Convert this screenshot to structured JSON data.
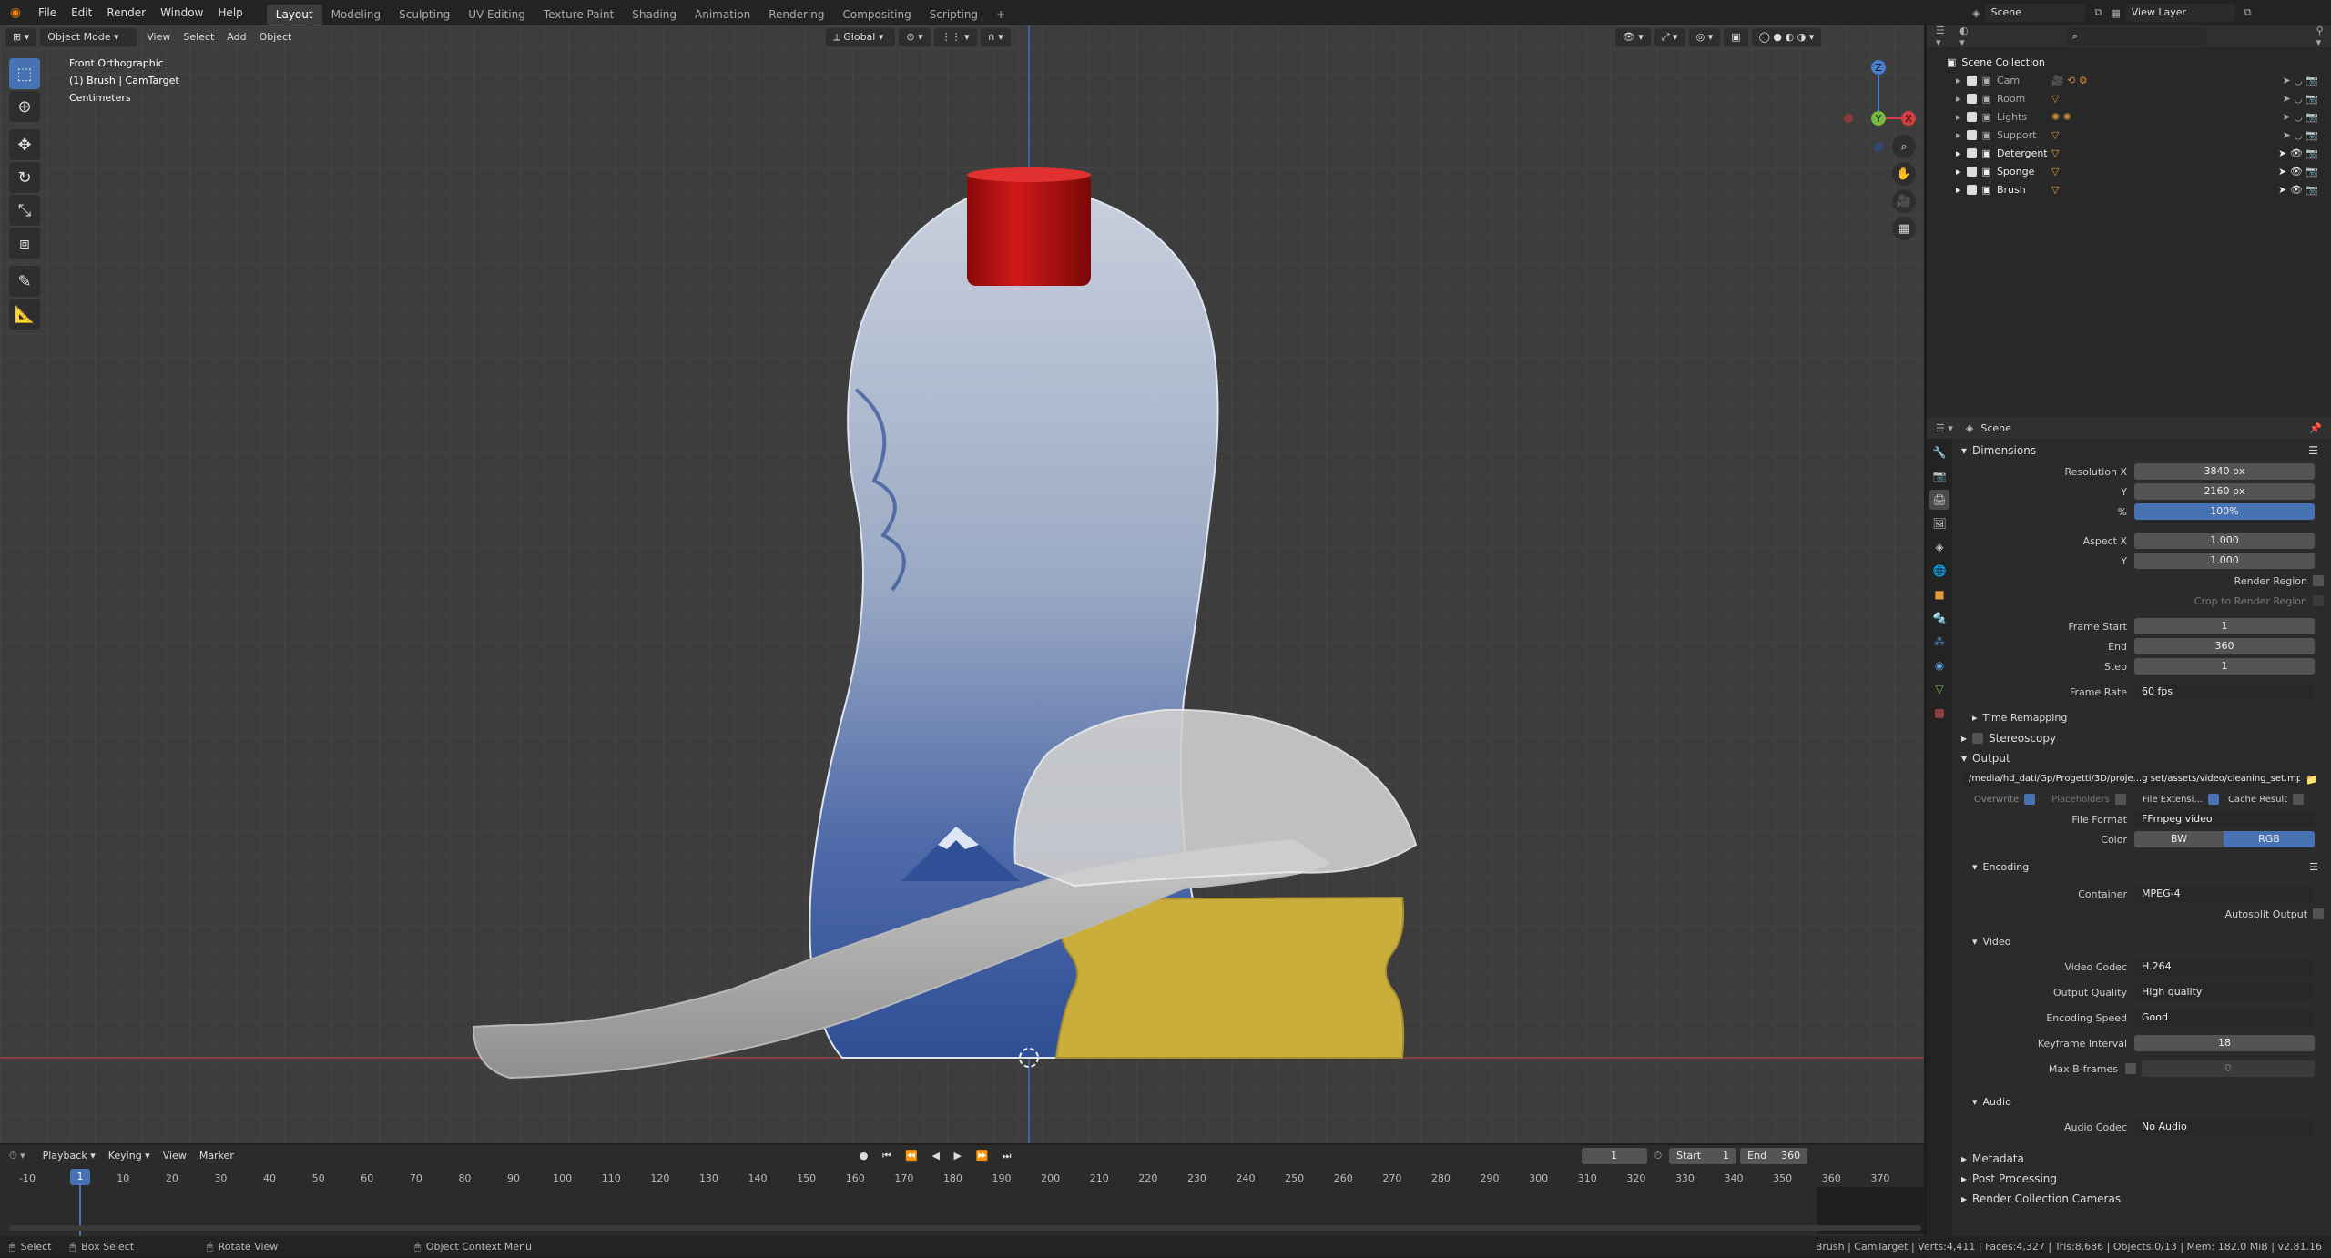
{
  "topbar": {
    "menus": [
      "File",
      "Edit",
      "Render",
      "Window",
      "Help"
    ],
    "workspaces": [
      "Layout",
      "Modeling",
      "Sculpting",
      "UV Editing",
      "Texture Paint",
      "Shading",
      "Animation",
      "Rendering",
      "Compositing",
      "Scripting"
    ],
    "active_workspace": "Layout",
    "add_tab": "+",
    "scene": "Scene",
    "view_layer": "View Layer"
  },
  "viewport": {
    "mode": "Object Mode",
    "menus": [
      "View",
      "Select",
      "Add",
      "Object"
    ],
    "orientation": "Global",
    "info_lines": [
      "Front Orthographic",
      "(1) Brush | CamTarget",
      "Centimeters"
    ],
    "gizmo": {
      "z": "Z",
      "y": "Y",
      "x": "X"
    }
  },
  "outliner": {
    "search_placeholder": "",
    "root": "Scene Collection",
    "items": [
      {
        "name": "Cam"
      },
      {
        "name": "Room"
      },
      {
        "name": "Lights"
      },
      {
        "name": "Support"
      },
      {
        "name": "Detergent"
      },
      {
        "name": "Sponge"
      },
      {
        "name": "Brush"
      }
    ]
  },
  "properties": {
    "context": "Scene",
    "dimensions": {
      "title": "Dimensions",
      "resolution_x_label": "Resolution X",
      "resolution_x": "3840 px",
      "y_label": "Y",
      "resolution_y": "2160 px",
      "pct_label": "%",
      "pct": "100%",
      "aspect_x_label": "Aspect X",
      "aspect_x": "1.000",
      "aspect_y_label": "Y",
      "aspect_y": "1.000",
      "render_region": "Render Region",
      "crop": "Crop to Render Region",
      "frame_start_label": "Frame Start",
      "frame_start": "1",
      "end_label": "End",
      "end": "360",
      "step_label": "Step",
      "step": "1",
      "frame_rate_label": "Frame Rate",
      "frame_rate": "60 fps"
    },
    "time_remapping": "Time Remapping",
    "stereoscopy": "Stereoscopy",
    "output": {
      "title": "Output",
      "path": "/media/hd_dati/Gp/Progetti/3D/proje...g set/assets/video/cleaning_set.mp4",
      "overwrite": "Overwrite",
      "placeholders": "Placeholders",
      "file_ext": "File Extensi...",
      "cache": "Cache Result",
      "file_format_label": "File Format",
      "file_format": "FFmpeg video",
      "color_label": "Color",
      "bw": "BW",
      "rgb": "RGB"
    },
    "encoding": {
      "title": "Encoding",
      "container_label": "Container",
      "container": "MPEG-4",
      "autosplit": "Autosplit Output"
    },
    "video": {
      "title": "Video",
      "codec_label": "Video Codec",
      "codec": "H.264",
      "quality_label": "Output Quality",
      "quality": "High quality",
      "speed_label": "Encoding Speed",
      "speed": "Good",
      "keyframe_label": "Keyframe Interval",
      "keyframe": "18",
      "bframes_label": "Max B-frames",
      "bframes": "0"
    },
    "audio": {
      "title": "Audio",
      "codec_label": "Audio Codec",
      "codec": "No Audio"
    },
    "collapsed": [
      "Metadata",
      "Post Processing",
      "Render Collection Cameras"
    ]
  },
  "timeline": {
    "menus": [
      "Playback",
      "Keying",
      "View",
      "Marker"
    ],
    "current_frame": "1",
    "start_label": "Start",
    "start": "1",
    "end_label": "End",
    "end": "360",
    "ticks": [
      "-10",
      "1",
      "10",
      "20",
      "30",
      "40",
      "50",
      "60",
      "70",
      "80",
      "90",
      "100",
      "110",
      "120",
      "130",
      "140",
      "150",
      "160",
      "170",
      "180",
      "190",
      "200",
      "210",
      "220",
      "230",
      "240",
      "250",
      "260",
      "270",
      "280",
      "290",
      "300",
      "310",
      "320",
      "330",
      "340",
      "350",
      "360",
      "370"
    ]
  },
  "statusbar": {
    "select": "Select",
    "box_select": "Box Select",
    "rotate": "Rotate View",
    "context_menu": "Object Context Menu",
    "stats": "Brush | CamTarget | Verts:4,411 | Faces:4,327 | Tris:8,686 | Objects:0/13 | Mem: 182.0 MiB | v2.81.16"
  },
  "colors": {
    "accent": "#4772b3",
    "bg": "#3d3d3d",
    "bottle_cap": "#c01010",
    "sponge": "#c9ae3c"
  }
}
